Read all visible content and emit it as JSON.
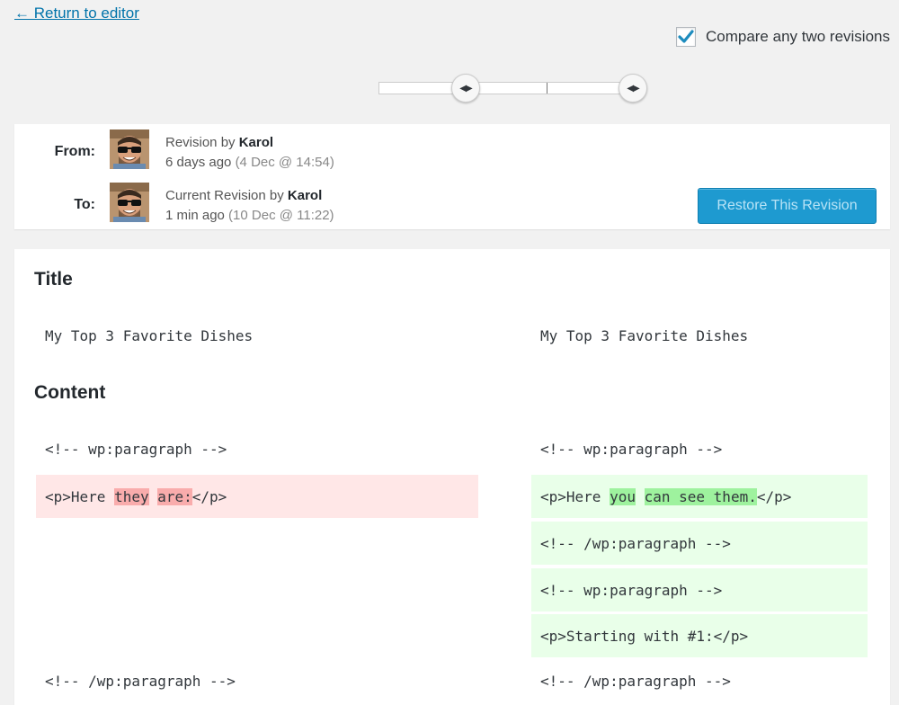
{
  "nav": {
    "return_label": "← Return to editor"
  },
  "compare": {
    "label": "Compare any two revisions",
    "checked": true
  },
  "slider": {
    "ticks": 3,
    "from_index": 0,
    "to_index": 2
  },
  "revisions": {
    "from": {
      "label": "From:",
      "prefix": "Revision by",
      "author": "Karol",
      "relative": "6 days ago",
      "date": "(4 Dec @ 14:54)"
    },
    "to": {
      "label": "To:",
      "prefix": "Current Revision by",
      "author": "Karol",
      "relative": "1 min ago",
      "date": "(10 Dec @ 11:22)"
    },
    "restore_label": "Restore This Revision"
  },
  "diff": {
    "title_heading": "Title",
    "title_left": "My Top 3 Favorite Dishes",
    "title_right": "My Top 3 Favorite Dishes",
    "content_heading": "Content",
    "left": {
      "line1": "<!-- wp:paragraph -->",
      "deleted": {
        "pre": "<p>Here ",
        "w1": "they",
        "mid": " ",
        "w2": "are:",
        "post": "</p>"
      },
      "line_last": "<!-- /wp:paragraph -->"
    },
    "right": {
      "line1": "<!-- wp:paragraph -->",
      "added": {
        "pre": "<p>Here ",
        "w1": "you",
        "mid": " ",
        "w2": "can see them.",
        "post": "</p>"
      },
      "added_lines": [
        "<!-- /wp:paragraph -->",
        "<!-- wp:paragraph -->",
        "<p>Starting with #1:</p>"
      ],
      "line_last": "<!-- /wp:paragraph -->"
    }
  },
  "colors": {
    "link": "#0073aa",
    "button": "#1e9ad0",
    "deleted_bg": "#ffe7e7",
    "deleted_word": "#f9acac",
    "added_bg": "#e9ffe9",
    "added_word": "#9ef29e"
  }
}
